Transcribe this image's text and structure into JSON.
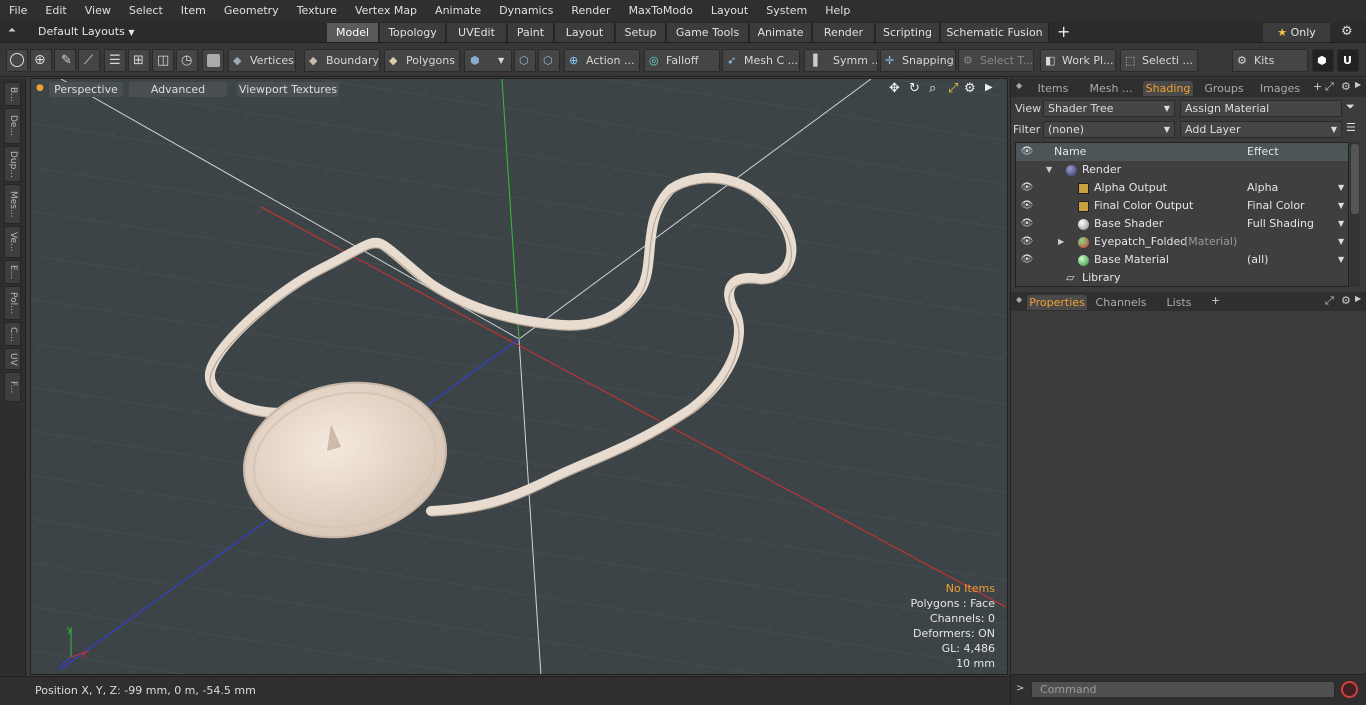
{
  "menu": [
    "File",
    "Edit",
    "View",
    "Select",
    "Item",
    "Geometry",
    "Texture",
    "Vertex Map",
    "Animate",
    "Dynamics",
    "Render",
    "MaxToModo",
    "Layout",
    "System",
    "Help"
  ],
  "layout_selector": "Default Layouts",
  "layout_tabs": [
    "Model",
    "Topology",
    "UVEdit",
    "Paint",
    "Layout",
    "Setup",
    "Game Tools",
    "Animate",
    "Render",
    "Scripting",
    "Schematic Fusion"
  ],
  "only_label": "Only",
  "toolbar": {
    "vertices": "Vertices",
    "boundary": "Boundary",
    "polygons": "Polygons",
    "action": "Action ...",
    "falloff": "Falloff",
    "mesh_c": "Mesh C ...",
    "symm": "Symm ...",
    "snapping": "Snapping",
    "select_t": "Select T...",
    "work_pl": "Work Pl...",
    "selecti": "Selecti ...",
    "kits": "Kits"
  },
  "left_tabs": [
    "B...",
    "De...",
    "Dup...",
    "Mes...",
    "Ve...",
    "E...",
    "Pol...",
    "C...",
    "UV",
    "F..."
  ],
  "viewport": {
    "perspective": "Perspective",
    "advanced": "Advanced",
    "viewport_textures": "Viewport Textures",
    "status": {
      "no_items": "No Items",
      "polygons": "Polygons : Face",
      "channels": "Channels: 0",
      "deformers": "Deformers: ON",
      "gl": "GL: 4,486",
      "scale": "10 mm"
    }
  },
  "position_readout": "Position X, Y, Z:  -99 mm, 0 m, -54.5 mm",
  "right_tabs": [
    "Items",
    "Mesh ...",
    "Shading",
    "Groups",
    "Images"
  ],
  "view_label": "View",
  "view_value": "Shader Tree",
  "assign_material": "Assign Material",
  "filter_label": "Filter",
  "filter_value": "(none)",
  "add_layer": "Add Layer",
  "shader_header": {
    "name": "Name",
    "effect": "Effect"
  },
  "shader_rows": [
    {
      "name": "Render",
      "effect": "",
      "icon": "render-sphere"
    },
    {
      "name": "Alpha Output",
      "effect": "Alpha",
      "icon": "output"
    },
    {
      "name": "Final Color Output",
      "effect": "Final Color",
      "icon": "output"
    },
    {
      "name": "Base Shader",
      "effect": "Full Shading",
      "icon": "shader-sphere"
    },
    {
      "name": "Eyepatch_Folded",
      "tag": "(Material)",
      "effect": "",
      "icon": "material-sphere"
    },
    {
      "name": "Base Material",
      "effect": "(all)",
      "icon": "base-material-sphere"
    },
    {
      "name": "Library",
      "effect": "",
      "icon": "folder"
    }
  ],
  "prop_tabs": [
    "Properties",
    "Channels",
    "Lists"
  ],
  "command_placeholder": "Command",
  "colors": {
    "accent": "#f0a030",
    "viewport_bg": "#3d4447",
    "x_axis": "#d03030",
    "y_axis": "#30c030",
    "z_axis": "#3040d0",
    "strap": "#e8dcd0"
  }
}
